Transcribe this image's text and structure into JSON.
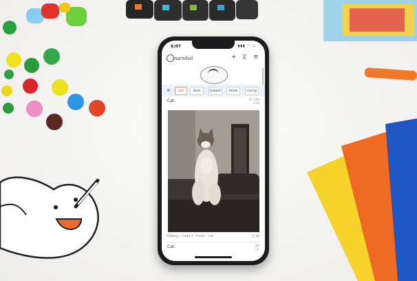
{
  "status_bar": {
    "time": "6:07",
    "icons": "▮▮▮ ◠ ▭"
  },
  "app": {
    "name": "narwhal"
  },
  "toolbar": {
    "add_label": "+",
    "filter_label": "⧖",
    "menu_label": "≡"
  },
  "sort_tabs": [
    "hot",
    "best",
    "lowest",
    "more",
    "rising"
  ],
  "sort_menu_label": "≡",
  "posts": [
    {
      "title": "Cat.",
      "meta_top": "25 18d",
      "meta_bottom": "+3d",
      "source_prefix": "",
      "source_sub": "Gallery",
      "source_rest": " · i.redd.it · Fixed: · Cat",
      "comment_count": "34"
    },
    {
      "title": "Cat.",
      "meta_top": "3M",
      "meta_bottom": "21"
    }
  ],
  "colors": {
    "accent": "#e05a2a",
    "sortbar": "#eaf3fb",
    "phone": "#1c1c1e",
    "link": "#3a6ea5"
  }
}
